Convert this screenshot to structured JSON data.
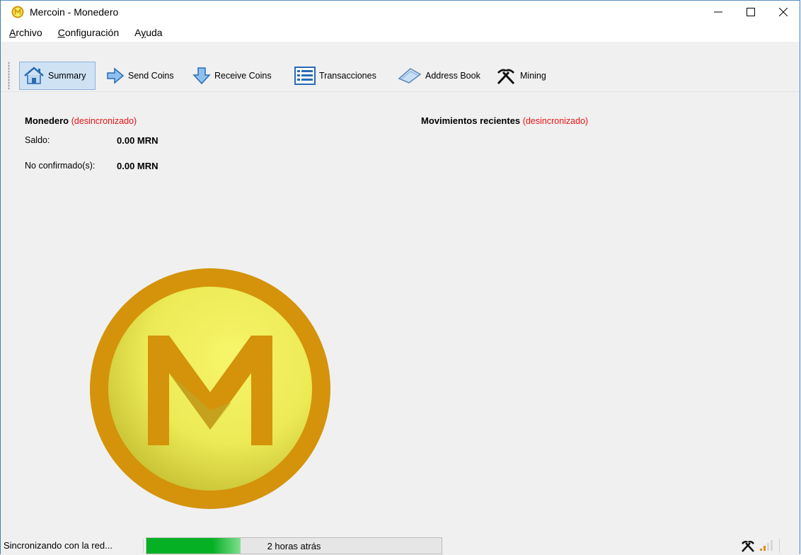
{
  "window": {
    "title": "Mercoin - Monedero",
    "controls": {
      "minimize": "—",
      "maximize": "☐",
      "close": "✕"
    }
  },
  "menu": [
    {
      "mnemonic": "A",
      "rest": "rchivo"
    },
    {
      "mnemonic": "C",
      "rest": "onfiguración"
    },
    {
      "prefix": "A",
      "mnemonic": "y",
      "rest": "uda"
    }
  ],
  "toolbar": {
    "summary": "Summary",
    "send": "Send Coins",
    "receive": "Receive Coins",
    "transactions": "Transacciones",
    "address_book": "Address Book",
    "mining": "Mining"
  },
  "wallet": {
    "heading": "Monedero",
    "sync_status": "(desincronizado)",
    "balance_label": "Saldo:",
    "balance_value": "0.00 MRN",
    "unconfirmed_label": "No confirmado(s):",
    "unconfirmed_value": "0.00 MRN"
  },
  "recent": {
    "heading": "Movimientos recientes",
    "sync_status": "(desincronizado)"
  },
  "status": {
    "sync_text": "Sincronizando con la red...",
    "progress_fraction": 0.32,
    "progress_text": "2 horas atrás"
  },
  "colors": {
    "accent": "#06b025",
    "error": "#ee1111",
    "coin_outer": "#d4930a",
    "coin_inner": "#f2f060"
  }
}
